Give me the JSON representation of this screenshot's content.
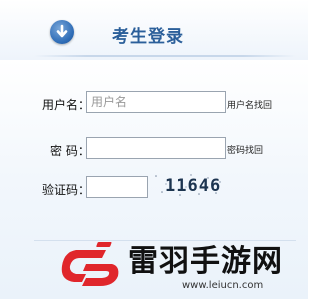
{
  "header": {
    "title": "考生登录"
  },
  "form": {
    "username_label": "用户名：",
    "username_placeholder": "用户名",
    "username_value": "",
    "find_username": "用户名找回",
    "password_label": "密 码：",
    "password_value": "",
    "find_password": "密码找回",
    "captcha_label": "验证码：",
    "captcha_value": "",
    "captcha_image_text": "11646"
  },
  "watermark": {
    "name": "雷羽手游网",
    "url": "www.leiucn.com"
  },
  "colors": {
    "title": "#2b5f9a",
    "accent_blue": "#2f6db7",
    "logo_red": "#e0262b"
  },
  "icons": {
    "header_icon": "down-arrow-circle-icon"
  }
}
